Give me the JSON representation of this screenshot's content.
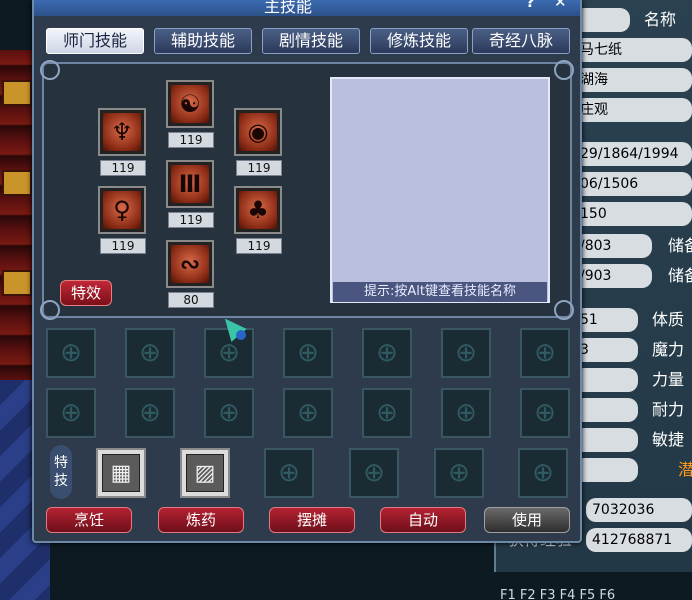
{
  "window": {
    "title": "主技能",
    "help_label": "?",
    "close_label": "✕"
  },
  "tabs": [
    {
      "label": "师门技能",
      "active": true
    },
    {
      "label": "辅助技能",
      "active": false
    },
    {
      "label": "剧情技能",
      "active": false
    },
    {
      "label": "修炼技能",
      "active": false
    },
    {
      "label": "奇经八脉",
      "active": false
    }
  ],
  "skills": [
    {
      "icon": "flame-figure-skill-icon",
      "glyph": "♆",
      "level": "119"
    },
    {
      "icon": "yin-yang-shield-skill-icon",
      "glyph": "☯",
      "level": "119"
    },
    {
      "icon": "taiji-seal-skill-icon",
      "glyph": "◉",
      "level": "119"
    },
    {
      "icon": "venus-symbol-skill-icon",
      "glyph": "♀",
      "level": "119"
    },
    {
      "icon": "gate-skill-icon",
      "glyph": "Ⅲ",
      "level": "119"
    },
    {
      "icon": "tree-skill-icon",
      "glyph": "♣",
      "level": "119"
    },
    {
      "icon": "constellation-skill-icon",
      "glyph": "∾",
      "level": "80"
    }
  ],
  "effects_button": "特效",
  "desc_hint": "提示:按Alt键查看技能名称",
  "special_skills": {
    "label": "特技",
    "items": [
      {
        "icon": "special-skill-1-icon",
        "glyph": "▦"
      },
      {
        "icon": "special-skill-2-icon",
        "glyph": "▨"
      }
    ]
  },
  "bottom_buttons": [
    "烹饪",
    "炼药",
    "摆摊",
    "自动",
    "使用"
  ],
  "right_panel": {
    "name_label": "名称",
    "name": "马七纸",
    "field2": "湖海",
    "field3": "庄观",
    "stat_hp": "29/1864/1994",
    "stat_mp": "06/1506",
    "stat_3": "150",
    "stat_4": "/803",
    "stat_5": "/903",
    "store_label_1": "储备",
    "store_label_2": "储备",
    "attr_vals": [
      "51",
      "3",
      "",
      "",
      "",
      ""
    ],
    "attrs": [
      "体质",
      "魔力",
      "力量",
      "耐力",
      "敏捷"
    ],
    "potential_label": "潜",
    "exp_current": "7032036",
    "exp_label": "获得经验",
    "exp_total": "412768871",
    "fkeys": "F1   F2   F3   F4   F5   F6"
  },
  "colors": {
    "accent_red": "#b42232",
    "panel_bg": "#2e3b4d",
    "desc_bg": "#b9bfdc",
    "orange_label": "#ff9a1a"
  }
}
